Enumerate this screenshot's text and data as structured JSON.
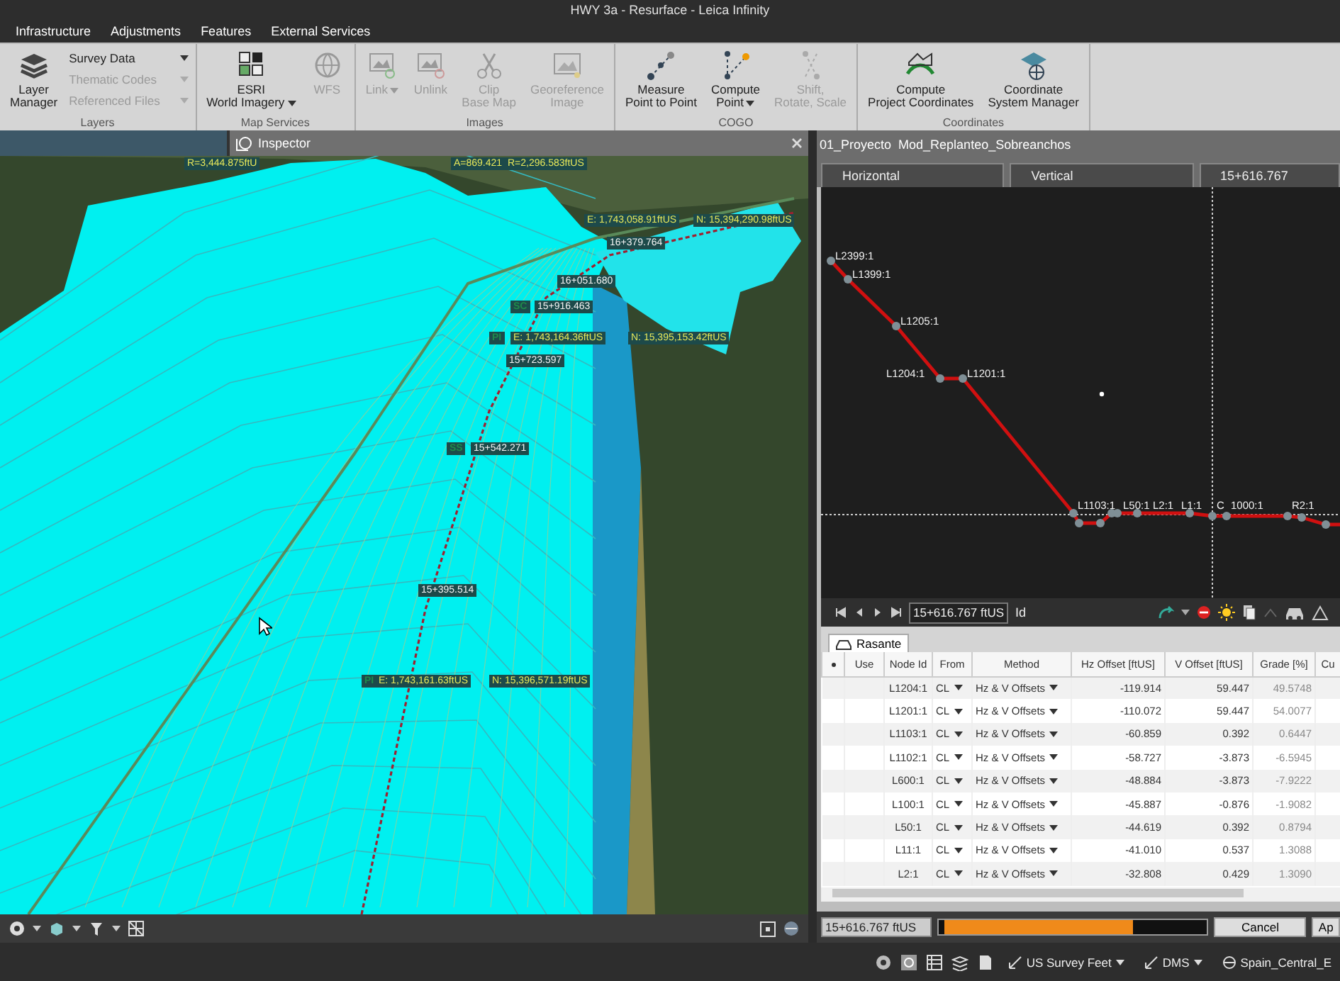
{
  "window": {
    "title": "HWY 3a - Resurface - Leica Infinity"
  },
  "menu": [
    "Infrastructure",
    "Adjustments",
    "Features",
    "External Services"
  ],
  "ribbon": [
    {
      "group": "Layers",
      "items": [
        {
          "kind": "large",
          "lines": [
            "Layer",
            "Manager"
          ],
          "dropdown": false,
          "disabled": false
        },
        {
          "kind": "stack",
          "entries": [
            {
              "label": "Survey Data",
              "disabled": false
            },
            {
              "label": "Thematic Codes",
              "disabled": true
            },
            {
              "label": "Referenced Files",
              "disabled": true
            }
          ]
        }
      ]
    },
    {
      "group": "Map Services",
      "items": [
        {
          "kind": "large",
          "lines": [
            "ESRI",
            "World Imagery"
          ],
          "dropdown": true,
          "disabled": false
        },
        {
          "kind": "large",
          "lines": [
            "WFS"
          ],
          "dropdown": false,
          "disabled": true
        }
      ]
    },
    {
      "group": "Images",
      "items": [
        {
          "kind": "large",
          "lines": [
            "Link"
          ],
          "dropdown": true,
          "disabled": true
        },
        {
          "kind": "large",
          "lines": [
            "Unlink"
          ],
          "dropdown": false,
          "disabled": true
        },
        {
          "kind": "large",
          "lines": [
            "Clip",
            "Base Map"
          ],
          "dropdown": false,
          "disabled": true
        },
        {
          "kind": "large",
          "lines": [
            "Georeference",
            "Image"
          ],
          "dropdown": false,
          "disabled": true
        }
      ]
    },
    {
      "group": "COGO",
      "items": [
        {
          "kind": "large",
          "lines": [
            "Measure",
            "Point to Point"
          ],
          "dropdown": false,
          "disabled": false
        },
        {
          "kind": "large",
          "lines": [
            "Compute",
            "Point"
          ],
          "dropdown": true,
          "disabled": false
        },
        {
          "kind": "large",
          "lines": [
            "Shift,",
            "Rotate, Scale"
          ],
          "dropdown": false,
          "disabled": true
        }
      ]
    },
    {
      "group": "Coordinates",
      "items": [
        {
          "kind": "large",
          "lines": [
            "Compute",
            "Project Coordinates"
          ],
          "dropdown": false,
          "disabled": false
        },
        {
          "kind": "large",
          "lines": [
            "Coordinate",
            "System Manager"
          ],
          "dropdown": false,
          "disabled": false
        }
      ]
    }
  ],
  "inspector": {
    "tab": "Inspector",
    "view_labels": [
      {
        "text": "R=3,444.875ftU",
        "kind": "coordinate"
      },
      {
        "text": "A=869.421",
        "kind": "coordinate"
      },
      {
        "text": "R=2,296.583ftUS",
        "kind": "coordinate"
      },
      {
        "text": "E: 1,743,058.91ftUS",
        "kind": "coordinate"
      },
      {
        "text": "N: 15,394,290.98ftUS",
        "kind": "coordinate"
      },
      {
        "text": "16+379.764",
        "kind": "station"
      },
      {
        "text": "16+051.680",
        "kind": "station"
      },
      {
        "text": "SC",
        "kind": "point"
      },
      {
        "text": "15+916.463",
        "kind": "station"
      },
      {
        "text": "PI",
        "kind": "point"
      },
      {
        "text": "E: 1,743,164.36ftUS",
        "kind": "coordinate"
      },
      {
        "text": "N: 15,395,153.42ftUS",
        "kind": "coordinate"
      },
      {
        "text": "15+723.597",
        "kind": "station"
      },
      {
        "text": "SS",
        "kind": "point"
      },
      {
        "text": "15+542.271",
        "kind": "station"
      },
      {
        "text": "15+395.514",
        "kind": "station"
      },
      {
        "text": "PI",
        "kind": "point"
      },
      {
        "text": "E: 1,743,161.63ftUS",
        "kind": "coordinate"
      },
      {
        "text": "N: 15,396,571.19ftUS",
        "kind": "coordinate"
      }
    ]
  },
  "profile": {
    "title": "01_Proyecto  Mod_Replanteo_Sobreanchos",
    "tabs": [
      "Horizontal",
      "Vertical",
      "15+616.767"
    ],
    "points": [
      "L2399:1",
      "L1399:1",
      "L1205:1",
      "L1204:1",
      "L1201:1",
      "L1103:1",
      "L50:1",
      "L2:1",
      "L1:1",
      "C",
      "1000:1",
      "R2:1"
    ],
    "station_field": "15+616.767 ftUS",
    "id_label": "Id",
    "table_tab": "Rasante",
    "columns": [
      "Use",
      "Node Id",
      "From",
      "Method",
      "Hz Offset [ftUS]",
      "V Offset [ftUS]",
      "Grade [%]",
      "Cu"
    ],
    "rows": [
      {
        "node": "L1204:1",
        "from": "CL",
        "method": "Hz & V Offsets",
        "hz": "-119.914",
        "v": "59.447",
        "grade": "49.5748"
      },
      {
        "node": "L1201:1",
        "from": "CL",
        "method": "Hz & V Offsets",
        "hz": "-110.072",
        "v": "59.447",
        "grade": "54.0077"
      },
      {
        "node": "L1103:1",
        "from": "CL",
        "method": "Hz & V Offsets",
        "hz": "-60.859",
        "v": "0.392",
        "grade": "0.6447"
      },
      {
        "node": "L1102:1",
        "from": "CL",
        "method": "Hz & V Offsets",
        "hz": "-58.727",
        "v": "-3.873",
        "grade": "-6.5945"
      },
      {
        "node": "L600:1",
        "from": "CL",
        "method": "Hz & V Offsets",
        "hz": "-48.884",
        "v": "-3.873",
        "grade": "-7.9222"
      },
      {
        "node": "L100:1",
        "from": "CL",
        "method": "Hz & V Offsets",
        "hz": "-45.887",
        "v": "-0.876",
        "grade": "-1.9082"
      },
      {
        "node": "L50:1",
        "from": "CL",
        "method": "Hz & V Offsets",
        "hz": "-44.619",
        "v": "0.392",
        "grade": "0.8794"
      },
      {
        "node": "L11:1",
        "from": "CL",
        "method": "Hz & V Offsets",
        "hz": "-41.010",
        "v": "0.537",
        "grade": "1.3088"
      },
      {
        "node": "L2:1",
        "from": "CL",
        "method": "Hz & V Offsets",
        "hz": "-32.808",
        "v": "0.429",
        "grade": "1.3090"
      }
    ]
  },
  "footer": {
    "station": "15+616.767 ftUS",
    "level": 0.72,
    "buttons": [
      "Cancel",
      "Ap"
    ]
  },
  "status": {
    "units": "US Survey Feet",
    "angle": "DMS",
    "system": "Spain_Central_E"
  }
}
